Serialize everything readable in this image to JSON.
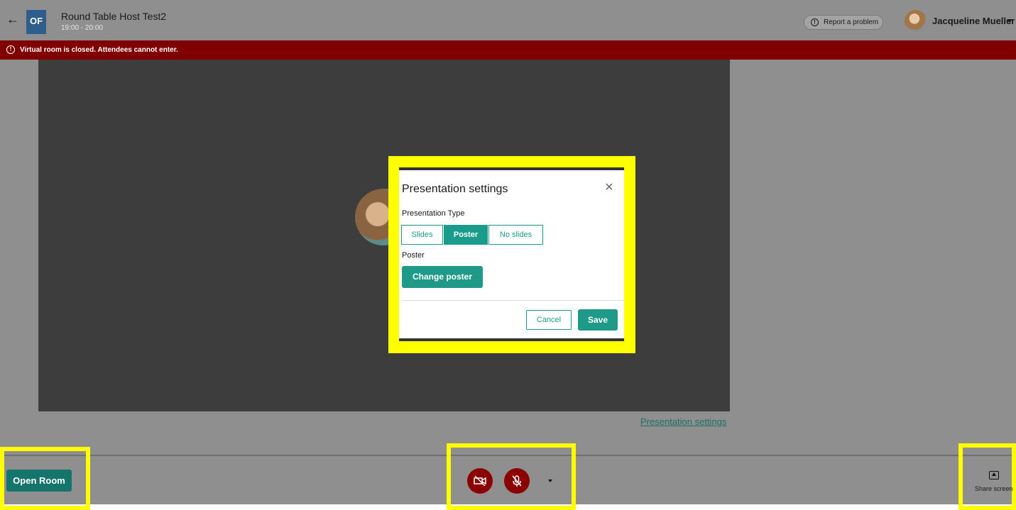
{
  "header": {
    "logo_text": "OF",
    "room_title": "Round Table Host Test2",
    "room_time": "19:00 - 20:00",
    "report_label": "Report a problem",
    "user_name": "Jacqueline Mueller"
  },
  "alert": {
    "text": "Virtual room is closed. Attendees cannot enter.",
    "color": "#800000"
  },
  "stage": {
    "presentation_settings_link": "Presentation settings"
  },
  "modal": {
    "title": "Presentation settings",
    "presentation_type_label": "Presentation Type",
    "types": [
      {
        "label": "Slides",
        "active": false
      },
      {
        "label": "Poster",
        "active": true
      },
      {
        "label": "No slides",
        "active": false
      }
    ],
    "poster_label": "Poster",
    "change_poster_label": "Change poster",
    "cancel_label": "Cancel",
    "save_label": "Save",
    "accent_color": "#1f9a89"
  },
  "bottombar": {
    "open_room_label": "Open Room",
    "camera_icon": "camera-off-icon",
    "mic_icon": "mic-off-icon",
    "share_screen_label": "Share screen",
    "highlight_color": "#ffff00"
  }
}
